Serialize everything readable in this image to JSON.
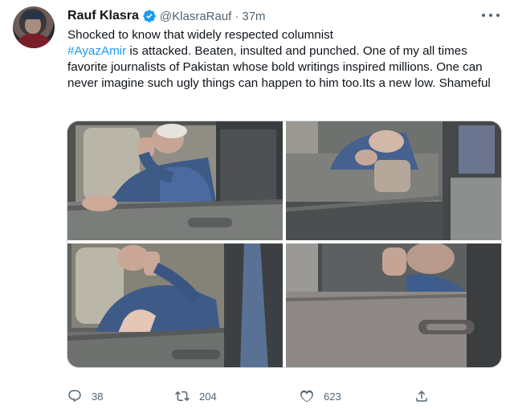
{
  "tweet": {
    "author": {
      "name": "Rauf Klasra",
      "handle": "@KlasraRauf",
      "verified": true,
      "avatar": "avatar"
    },
    "separator": "·",
    "time": "37m",
    "text": {
      "line_before_hashtag": "Shocked to know that widely respected columnist",
      "hashtag": "#AyazAmir",
      "after_hashtag": " is attacked. Beaten, insulted and punched. One of my all times favorite journalists of Pakistan whose bold writings inspired millions. One can never imagine such ugly things can happen to him too.Its a new low. Shameful"
    },
    "media": [
      {
        "icon": "photo-car-window-1"
      },
      {
        "icon": "photo-car-window-2"
      },
      {
        "icon": "photo-car-window-3"
      },
      {
        "icon": "photo-car-window-4"
      }
    ],
    "actions": {
      "reply": {
        "icon": "reply-icon",
        "count": "38"
      },
      "retweet": {
        "icon": "retweet-icon",
        "count": "204"
      },
      "like": {
        "icon": "like-icon",
        "count": "623"
      },
      "share": {
        "icon": "share-icon"
      }
    },
    "menu_icon": "more-icon"
  },
  "colors": {
    "accent": "#1d9bf0",
    "muted": "#536471",
    "text": "#0f1419",
    "border": "#cfd9de"
  }
}
